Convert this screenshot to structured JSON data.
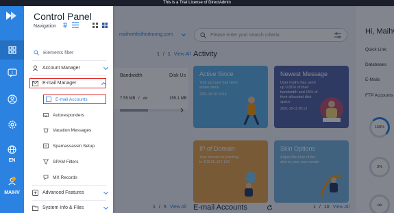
{
  "banner": {
    "text": "This is a Trial License of DirectAdmin"
  },
  "rail": {
    "language": "EN",
    "user": "MAIHV",
    "icons": [
      "grid-icon",
      "help-bubble-icon",
      "user-circle-icon",
      "settings-icon",
      "globe-icon",
      "user-icon"
    ]
  },
  "panel": {
    "title": "Control Panel",
    "navigation_label": "Navigation",
    "filter_placeholder": "Elements filter",
    "sections": {
      "account_manager": "Account Manager",
      "email_manager": "E-mail Manager",
      "advanced_features": "Advanced Features",
      "system_info": "System Info & Files"
    },
    "email_items": [
      "E-mail Accounts",
      "Autoresponders",
      "Vacation Messages",
      "Spamassassin Setup",
      "SPAM Filters",
      "MX Records"
    ]
  },
  "main": {
    "domain": "maihinhledhoitruong.com",
    "search_placeholder": "Please enter your search criteria",
    "top_pager": {
      "current": "1",
      "sep": "/",
      "total": "1",
      "view_all": "View All"
    },
    "bottom_pager_left": {
      "current": "1",
      "sep": "/",
      "total": "5",
      "view_all": "View All"
    },
    "bottom_pager_right": {
      "current": "1",
      "sep": "/",
      "total": "10",
      "view_all": "View All"
    },
    "activity_title": "Activity",
    "email_accounts_title": "E-mail Accounts",
    "table": {
      "col_bandwidth": "Bandwidth",
      "col_disk": "Disk Us",
      "bandwidth_value": "7.55 MB",
      "bandwidth_sep": "/",
      "bandwidth_limit": "∞",
      "disk_value": "155.1 MB",
      "progress": 0.45
    },
    "cards": [
      {
        "title": "Active Since",
        "desc": "Your account has been active since",
        "date": "2021-10-10 13:16",
        "color": "#5fb3e8"
      },
      {
        "title": "Newest Message",
        "desc": "User maihv has used up 0.81% of their bandwidth and 15% of their allocated disk space",
        "date": "2021-10-11 00:13",
        "color": "#5464a8"
      },
      {
        "title": "IP of Domain",
        "desc": "Your domain is pointing to 103.56.157.160",
        "date": "",
        "color": "#e9a44e"
      },
      {
        "title": "Skin Options",
        "desc": "Adjust the look of the skin to your own needs",
        "date": "",
        "color": "#78b5e0"
      }
    ]
  },
  "right": {
    "greeting": "Hi, Maihv",
    "quick_link": "Quick Link:",
    "databases": "Databases",
    "emails": "E-Mails",
    "ftp": "FTP Accounts",
    "gauge1": "158%",
    "gauge2": "3%",
    "gauge3": "∞"
  }
}
